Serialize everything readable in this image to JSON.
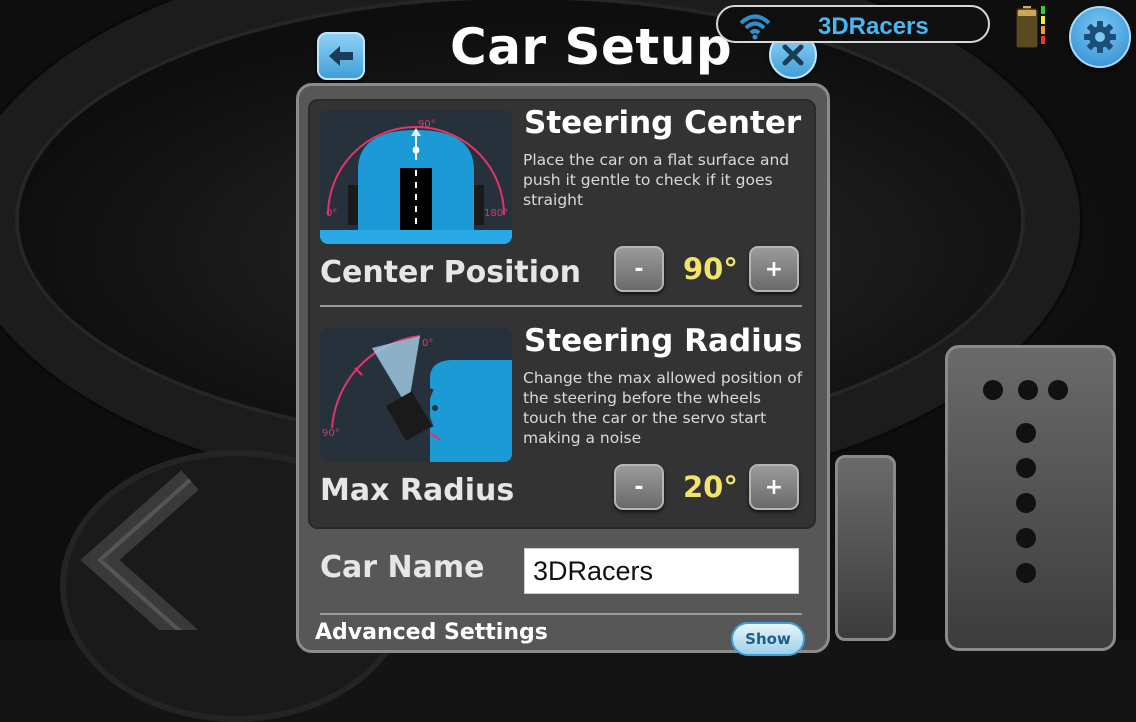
{
  "header": {
    "title": "Car Setup",
    "device_name": "3DRacers"
  },
  "steering_center": {
    "title": "Steering Center",
    "description": "Place the car on a flat surface and push it gentle to check if it goes straight",
    "diagram_labels": [
      "90°",
      "0°",
      "180°"
    ],
    "row_label": "Center Position",
    "value": "90°",
    "minus_label": "-",
    "plus_label": "+"
  },
  "steering_radius": {
    "title": "Steering Radius",
    "description": "Change the max allowed position of the steering before the wheels touch the car or the servo start making a noise",
    "diagram_labels": [
      "0°",
      "90°"
    ],
    "row_label": "Max Radius",
    "value": "20°",
    "minus_label": "-",
    "plus_label": "+"
  },
  "car_name": {
    "label": "Car Name",
    "value": "3DRacers"
  },
  "advanced": {
    "label": "Advanced Settings",
    "show_label": "Show"
  },
  "colors": {
    "accent_blue": "#48b6f0",
    "value_yellow": "#f2e36b",
    "diagram_pink": "#e0356b"
  },
  "icons": [
    "back-arrow-icon",
    "close-icon",
    "wifi-icon",
    "battery-icon",
    "gear-icon"
  ]
}
